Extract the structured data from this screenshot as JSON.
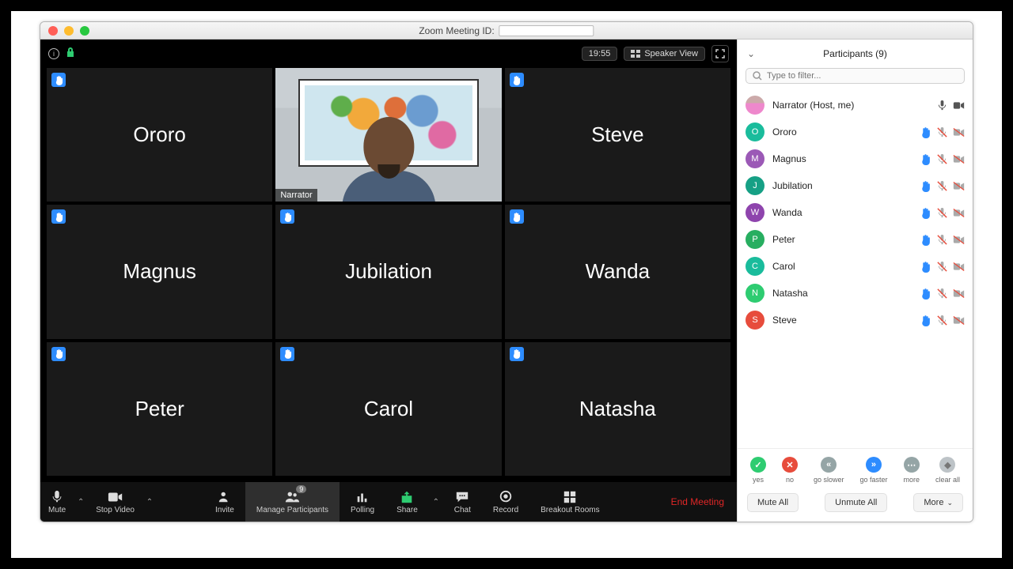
{
  "titlebar": {
    "title": "Zoom Meeting ID:"
  },
  "video": {
    "time": "19:55",
    "view_button": "Speaker View",
    "tiles": [
      {
        "name": "Ororo",
        "hand": true,
        "active": false
      },
      {
        "name": "Narrator",
        "hand": false,
        "active": true,
        "tag": "Narrator"
      },
      {
        "name": "Steve",
        "hand": true,
        "active": false
      },
      {
        "name": "Magnus",
        "hand": true,
        "active": false
      },
      {
        "name": "Jubilation",
        "hand": true,
        "active": false
      },
      {
        "name": "Wanda",
        "hand": true,
        "active": false
      },
      {
        "name": "Peter",
        "hand": true,
        "active": false
      },
      {
        "name": "Carol",
        "hand": true,
        "active": false
      },
      {
        "name": "Natasha",
        "hand": true,
        "active": false
      }
    ]
  },
  "toolbar": {
    "mute": "Mute",
    "stop_video": "Stop Video",
    "invite": "Invite",
    "manage": "Manage Participants",
    "manage_count": "9",
    "polling": "Polling",
    "share": "Share",
    "chat": "Chat",
    "record": "Record",
    "breakout": "Breakout Rooms",
    "end": "End Meeting"
  },
  "panel": {
    "title": "Participants (9)",
    "search_placeholder": "Type to filter...",
    "rows": [
      {
        "name": "Narrator (Host, me)",
        "initial": "",
        "color": "img",
        "hand": false,
        "mic": "on",
        "cam": "on"
      },
      {
        "name": "Ororo",
        "initial": "O",
        "color": "#1abc9c",
        "hand": true,
        "mic": "off",
        "cam": "off"
      },
      {
        "name": "Magnus",
        "initial": "M",
        "color": "#9b59b6",
        "hand": true,
        "mic": "off",
        "cam": "off"
      },
      {
        "name": "Jubilation",
        "initial": "J",
        "color": "#16a085",
        "hand": true,
        "mic": "off",
        "cam": "off"
      },
      {
        "name": "Wanda",
        "initial": "W",
        "color": "#8e44ad",
        "hand": true,
        "mic": "off",
        "cam": "off"
      },
      {
        "name": "Peter",
        "initial": "P",
        "color": "#27ae60",
        "hand": true,
        "mic": "off",
        "cam": "off"
      },
      {
        "name": "Carol",
        "initial": "C",
        "color": "#1abc9c",
        "hand": true,
        "mic": "off",
        "cam": "off"
      },
      {
        "name": "Natasha",
        "initial": "N",
        "color": "#2ecc71",
        "hand": true,
        "mic": "off",
        "cam": "off"
      },
      {
        "name": "Steve",
        "initial": "S",
        "color": "#e74c3c",
        "hand": true,
        "mic": "off",
        "cam": "off"
      }
    ],
    "nonverbal": [
      {
        "label": "yes",
        "color": "#2ecc71",
        "icon": "check"
      },
      {
        "label": "no",
        "color": "#e74c3c",
        "icon": "x"
      },
      {
        "label": "go slower",
        "color": "#95a5a6",
        "icon": "slow"
      },
      {
        "label": "go faster",
        "color": "#2d8cff",
        "icon": "fast"
      },
      {
        "label": "more",
        "color": "#95a5a6",
        "icon": "more"
      },
      {
        "label": "clear all",
        "color": "#bdc3c7",
        "icon": "clear"
      }
    ],
    "footer": {
      "mute_all": "Mute All",
      "unmute_all": "Unmute All",
      "more": "More"
    }
  }
}
